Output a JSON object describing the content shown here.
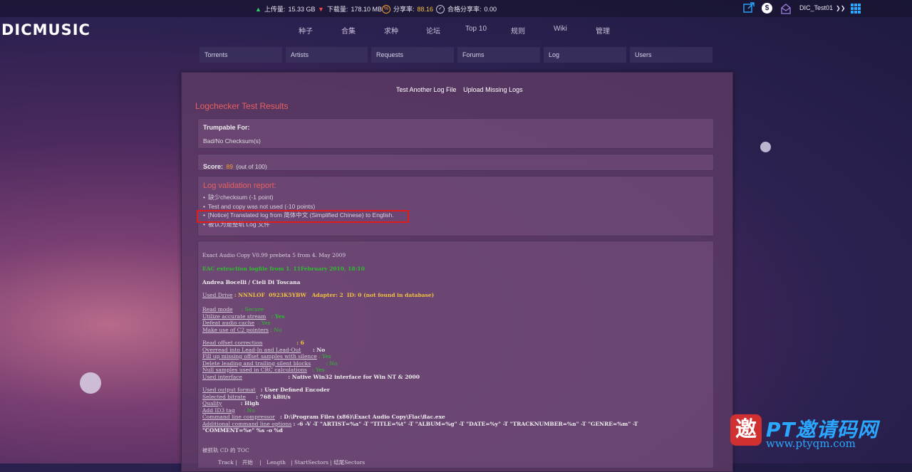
{
  "topbar": {
    "upload_label": "上传量:",
    "upload_value": "15.33 GB",
    "download_label": "下载量:",
    "download_value": "178.10 MB",
    "ratio_label": "分享率:",
    "ratio_value": "88.16",
    "req_ratio_label": "合格分享率:",
    "req_ratio_value": "0.00",
    "username": "DIC_Test01"
  },
  "logo": "DICMUSIC",
  "mainnav": [
    "种子",
    "合集",
    "求种",
    "论坛",
    "Top 10",
    "规则",
    "Wiki",
    "管理"
  ],
  "subnav": [
    "Torrents",
    "Artists",
    "Requests",
    "Forums",
    "Log",
    "Users"
  ],
  "links": {
    "test_another": "Test Another Log File",
    "upload_missing": "Upload Missing Logs"
  },
  "title": "Logchecker Test Results",
  "trumpable": {
    "label": "Trumpable For:",
    "reason": "Bad/No Checksum(s)"
  },
  "score": {
    "label": "Score:",
    "value": "89",
    "suffix": "(out of 100)"
  },
  "validation": {
    "title": "Log validation report:",
    "items": [
      "缺少checksum (-1 point)",
      "Test and copy was not used (-10 points)",
      "[Notice] Translated log from 简体中文 (Simplified Chinese) to English.",
      "被认为是整轨 Log 文件"
    ]
  },
  "log": {
    "l1": "Exact Audio Copy V0.99 prebeta 5 from 4. May 2009",
    "l2": "EAC extraction logfile from 1. 11February 2010, 18:10",
    "l3": "Andrea Bocelli / Cieli Di Toscana",
    "drive_label": "Used Drive",
    "drive_value": ": NNNLOF  0923K5YBW   Adapter: 2  ID: 0 (not found in database)",
    "read_mode_label": "Read mode",
    "read_mode_value": ": Secure",
    "accurate_label": "Utilize accurate stream",
    "accurate_value": ": Yes",
    "cache_label": "Defeat audio cache",
    "cache_value": ": Yes",
    "c2_label": "Make use of C2 pointers",
    "c2_value": ": No",
    "offset_label": "Read offset correction",
    "offset_value": ": 6",
    "overread_label": "Overread into Lead-In and Lead-Out",
    "overread_value": ": No",
    "fillup_label": "Fill up missing offset samples with silence",
    "fillup_value": ": Yes",
    "delete_label": "Delete leading and trailing silent blocks",
    "delete_value": ": No",
    "null_label": "Null samples used in CRC calculations",
    "null_value": ": Yes",
    "iface_label": "Used interface",
    "iface_value": ": Native Win32 interface for Win NT & 2000",
    "outfmt_label": "Used output format",
    "outfmt_value": ": User Defined Encoder",
    "bitrate_label": "Selected bitrate",
    "bitrate_value": ": 768 kBit/s",
    "quality_label": "Quality",
    "quality_value": ": High",
    "id3_label": "Add ID3 tag",
    "id3_value": ": No",
    "cmd_label": "Command line compressor",
    "cmd_value": ": D:\\Program Files (x86)\\Exact Audio Copy\\Flac\\flac.exe",
    "addl_label": "Additional command line options",
    "addl_value": ": -6 -V -T \"ARTIST=%a\" -T \"TITLE=%t\" -T \"ALBUM=%g\" -T \"DATE=%y\" -T \"TRACKNUMBER=%n\" -T \"GENRE=%m\" -T",
    "addl_value2": "\"COMMENT=%e\" %s -o %d",
    "toc_title": "被抓轨 CD 的 TOC",
    "toc_header": "Track |   开始    |   Length   | StartSectors | 结尾Sectors"
  },
  "watermark": {
    "seal": "邀",
    "big": "PT邀请码网",
    "small": "www.ptyqm.com"
  }
}
